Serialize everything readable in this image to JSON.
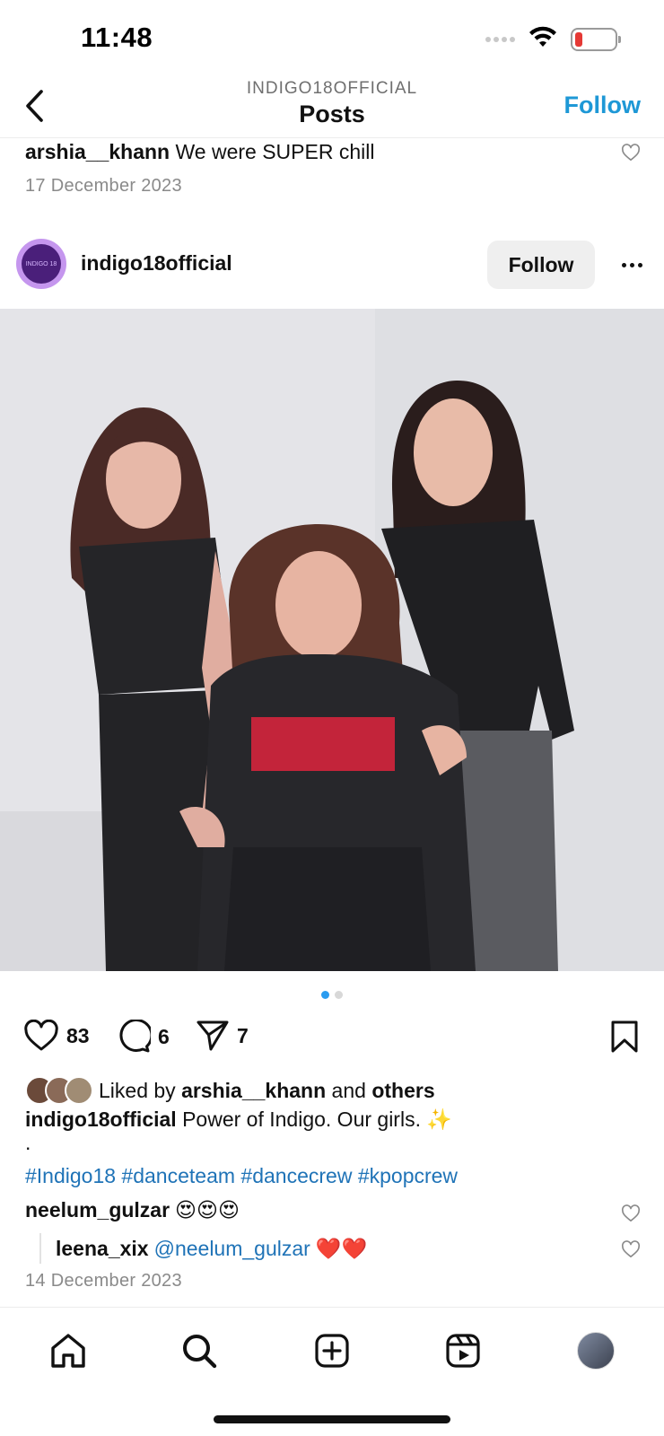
{
  "status": {
    "time": "11:48"
  },
  "header": {
    "account": "INDIGO18OFFICIAL",
    "title": "Posts",
    "follow_label": "Follow"
  },
  "previous_post": {
    "username": "arshia__khann",
    "caption": " We were SUPER chill",
    "date": "17 December 2023"
  },
  "post": {
    "avatar_text": "INDIGO 18",
    "username": "indigo18official",
    "follow_label": "Follow",
    "carousel": {
      "count": 2,
      "active": 1
    },
    "likes": "83",
    "comments": "6",
    "shares": "7",
    "liked_prefix": "Liked by ",
    "liked_user": "arshia__khann",
    "liked_mid": " and ",
    "liked_others": "others",
    "caption_user": "indigo18official",
    "caption_text": " Power of Indigo. Our girls. ✨",
    "caption_dot": ".",
    "hashtags": "#Indigo18 #danceteam #dancecrew #kpopcrew",
    "comment": {
      "user": "neelum_gulzar",
      "text": "😍😍😍"
    },
    "reply": {
      "user": "leena_xix",
      "mention": "@neelum_gulzar",
      "text": "❤️❤️"
    },
    "date": "14 December 2023"
  },
  "tabs": [
    "home-icon",
    "search-icon",
    "create-icon",
    "reels-icon",
    "profile-avatar"
  ],
  "colors": {
    "accent": "#1e98d6",
    "link": "#1f73b7",
    "dot_active": "#2a9cf0",
    "battery_low": "#e53935"
  }
}
